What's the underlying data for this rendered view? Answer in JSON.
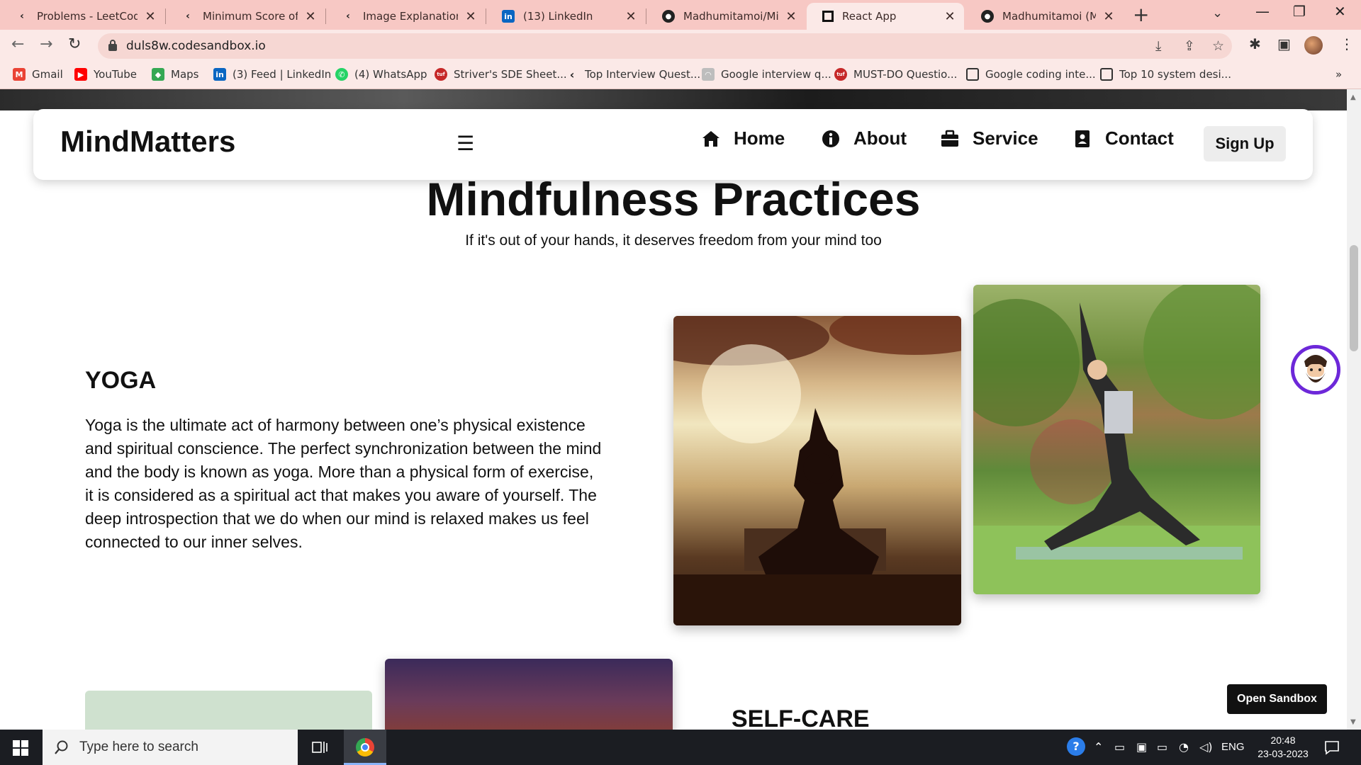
{
  "browser": {
    "tabs": [
      {
        "title": "Problems - LeetCode",
        "icon": "leetcode-icon"
      },
      {
        "title": "Minimum Score of a P",
        "icon": "leetcode-icon"
      },
      {
        "title": "Image Explanation🏆",
        "icon": "leetcode-icon"
      },
      {
        "title": "(13) LinkedIn",
        "icon": "linkedin-icon"
      },
      {
        "title": "Madhumitamoi/Mind",
        "icon": "github-icon"
      },
      {
        "title": "React App",
        "icon": "codesandbox-icon",
        "active": true
      },
      {
        "title": "Madhumitamoi (Mad",
        "icon": "github-icon"
      }
    ],
    "url": "duls8w.codesandbox.io",
    "bookmarks": [
      {
        "label": "Gmail",
        "icon": "gmail-icon",
        "color": "#ea4335"
      },
      {
        "label": "YouTube",
        "icon": "youtube-icon",
        "color": "#ff0000"
      },
      {
        "label": "Maps",
        "icon": "maps-icon",
        "color": "#34a853"
      },
      {
        "label": "(3) Feed | LinkedIn",
        "icon": "linkedin-icon",
        "color": "#0a66c2"
      },
      {
        "label": "(4) WhatsApp",
        "icon": "whatsapp-icon",
        "color": "#25d366"
      },
      {
        "label": "Striver's SDE Sheet...",
        "icon": "tuf-icon",
        "color": "#c62828"
      },
      {
        "label": "Top Interview Quest...",
        "icon": "leetcode-icon",
        "color": "#f5a623"
      },
      {
        "label": "Google interview q...",
        "icon": "geeks-icon",
        "color": "#9e9e9e"
      },
      {
        "label": "MUST-DO Questio...",
        "icon": "tuf-icon",
        "color": "#c62828"
      },
      {
        "label": "Google coding inte...",
        "icon": "page-icon",
        "color": "#333333"
      },
      {
        "label": "Top 10 system desi...",
        "icon": "page-icon",
        "color": "#333333"
      }
    ]
  },
  "site": {
    "brand": "MindMatters",
    "nav": {
      "home": "Home",
      "about": "About",
      "service": "Service",
      "contact": "Contact",
      "signup": "Sign Up"
    },
    "title": "Mindfulness Practices",
    "subtitle": "If it's out of your hands, it deserves freedom from your mind too",
    "sections": {
      "yoga": {
        "heading": "YOGA",
        "text": "Yoga is the ultimate act of harmony between one’s physical existence and spiritual conscience. The perfect synchronization between the mind and the body is known as yoga. More than a physical form of exercise, it is considered as a spiritual act that makes you aware of yourself. The deep introspection that we do when our mind is relaxed makes us feel connected to our inner selves."
      },
      "selfcare": {
        "heading": "SELF-CARE"
      }
    },
    "open_sandbox": "Open Sandbox"
  },
  "taskbar": {
    "search_placeholder": "Type here to search",
    "lang": "ENG",
    "time": "20:48",
    "date": "23-03-2023"
  }
}
